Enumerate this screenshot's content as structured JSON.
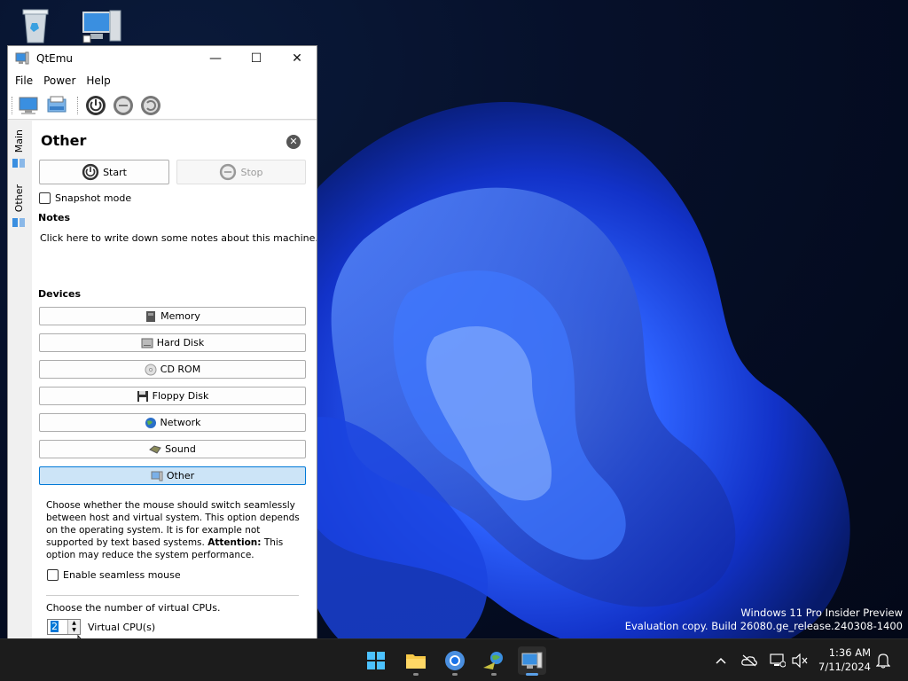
{
  "window": {
    "title": "QtEmu",
    "minimize": "—",
    "maximize": "☐",
    "close": "✕"
  },
  "menu": [
    "File",
    "Power",
    "Help"
  ],
  "side_tabs": [
    "Main",
    "Other"
  ],
  "panel": {
    "title": "Other",
    "start_label": "Start",
    "stop_label": "Stop",
    "snapshot_label": "Snapshot mode",
    "notes_heading": "Notes",
    "notes_placeholder": "Click here to write down some notes about this machine.",
    "devices_heading": "Devices",
    "devices": [
      "Memory",
      "Hard Disk",
      "CD ROM",
      "Floppy Disk",
      "Network",
      "Sound",
      "Other"
    ],
    "selected_device": "Other",
    "description_part1": "Choose whether the mouse should switch seamlessly between host and virtual system. This option depends on the operating system. It is for example not supported by text based systems. ",
    "description_attention": "Attention:",
    "description_part2": " This option may reduce the system performance.",
    "seamless_label": "Enable seamless mouse",
    "cpu_prompt": "Choose the number of virtual CPUs.",
    "cpu_value": "2",
    "cpu_label": "Virtual CPU(s)"
  },
  "watermark": {
    "line1": "Windows 11 Pro Insider Preview",
    "line2": "Evaluation copy. Build 26080.ge_release.240308-1400"
  },
  "clock": {
    "time": "1:36 AM",
    "date": "7/11/2024"
  },
  "colors": {
    "accent": "#0078d7",
    "selected_bg": "#cce4f7",
    "taskbar": "#1c1c1c"
  }
}
